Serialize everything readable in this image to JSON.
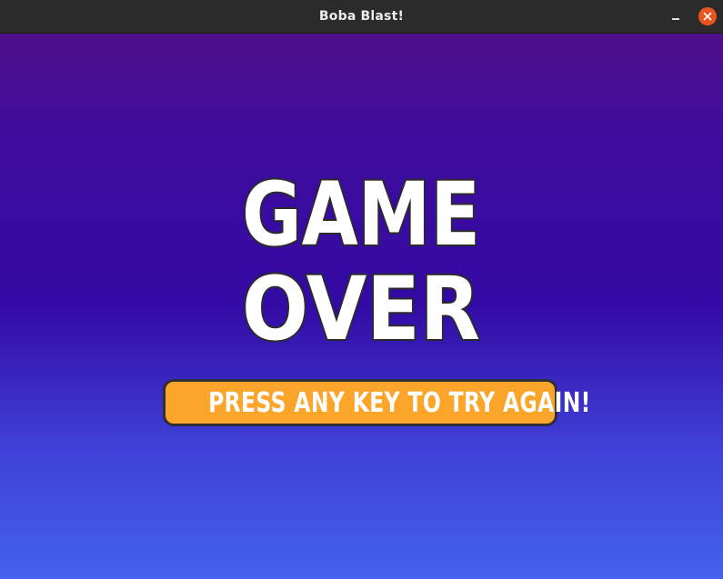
{
  "window": {
    "title": "Boba Blast!",
    "controls": {
      "minimize_icon": "minimize-icon",
      "close_icon": "close-icon"
    }
  },
  "game": {
    "screen": "game-over",
    "headline_line1": "GAME",
    "headline_line2": "OVER",
    "prompt": "PRESS ANY KEY TO TRY AGAIN!"
  },
  "colors": {
    "titlebar": "#2b2b2b",
    "close_button": "#e9541f",
    "background_top": "#4e0f88",
    "background_middle": "#330aa4",
    "background_bottom": "#4462ee",
    "banner_fill": "#fba52b",
    "banner_border": "#2f2f3a",
    "headline_fill": "#ffffff",
    "headline_outline": "#2b2b2b"
  }
}
